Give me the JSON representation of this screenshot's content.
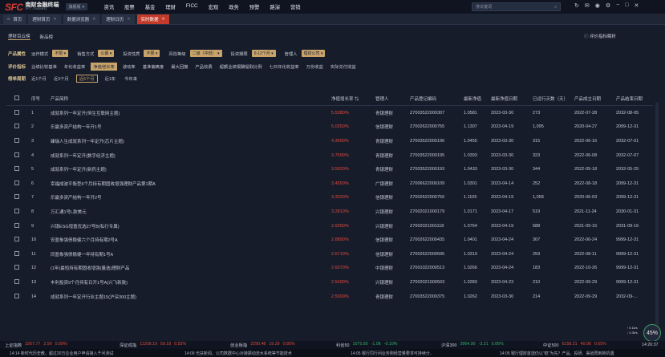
{
  "app": {
    "logo_mark": "SFC",
    "logo_cn": "南财金融终端",
    "logo_en": "SFC CHANNEL",
    "version": "旗舰版"
  },
  "nav": [
    "资讯",
    "股票",
    "基金",
    "理财",
    "FICC",
    "宏观",
    "政务",
    "预警",
    "路演",
    "营销"
  ],
  "search": {
    "placeholder": "搜关键词"
  },
  "tabs": [
    {
      "label": "首页"
    },
    {
      "label": "理财首页"
    },
    {
      "label": "数据浏览器"
    },
    {
      "label": "理财日历"
    },
    {
      "label": "实时数据"
    }
  ],
  "subtabs": {
    "items": [
      "理财百云榜",
      "新品榜"
    ],
    "rating_link": "评价指标解析"
  },
  "filters": {
    "row1": {
      "label": "产品属性",
      "items": [
        {
          "name": "运作模式",
          "value": "不限"
        },
        {
          "name": "销售方式",
          "value": "公募"
        },
        {
          "name": "投资性质",
          "value": "不限"
        },
        {
          "name": "风险等级",
          "value": "二级（中低）"
        },
        {
          "name": "投资期限",
          "value": "6-12个月"
        },
        {
          "name": "管理人",
          "value": "理财公司"
        }
      ]
    },
    "row2": {
      "label": "评价指标",
      "items": [
        "业绩比较基准",
        "年化收益率",
        "净值增长率",
        "波动率",
        "基准偏离度",
        "最大回撤",
        "产品收费",
        "超额业绩报酬提取比例",
        "七日年化收益率",
        "万份收益",
        "实际兑付收益"
      ],
      "active": "净值增长率"
    },
    "row3": {
      "label": "榜单周期",
      "items": [
        "近1个月",
        "近3个月",
        "近6个月",
        "近1年",
        "今年来"
      ],
      "active": "近6个月"
    }
  },
  "table": {
    "headers": [
      "序号",
      "产品简称",
      "净值增长率",
      "管理人",
      "产品登记编码",
      "最新净值",
      "最新净值日期",
      "已运行天数（天）",
      "产品成立日期",
      "产品结束日期"
    ],
    "rows": [
      [
        "1",
        "成就系列一年定开(恒生互联网主题)",
        "5.5380%",
        "青银理财",
        "Z7003522000307",
        "1.0581",
        "2023-03-30",
        "273",
        "2022-07-28",
        "2032-08-05"
      ],
      [
        "2",
        "乐赢多资产结构一年开1号",
        "5.0250%",
        "信银理财",
        "Z7002622000755",
        "1.1307",
        "2023-04-19",
        "1,095",
        "2020-04-27",
        "2099-12-31"
      ],
      [
        "3",
        "臻瑞人生成就系列一年定开(芯片主题)",
        "4.3690%",
        "青银理财",
        "Z7003522000196",
        "1.0455",
        "2023-03-30",
        "315",
        "2022-06-16",
        "2032-07-01"
      ],
      [
        "4",
        "成就系列一年定开(数字经济主题)",
        "3.7590%",
        "青银理财",
        "Z7003522000195",
        "1.0393",
        "2023-03-30",
        "323",
        "2022-06-08",
        "2032-07-07"
      ],
      [
        "5",
        "成就系列一年定开(新药主题)",
        "3.5620%",
        "青银理财",
        "Z7003522000193",
        "1.0433",
        "2023-03-30",
        "344",
        "2022-05-18",
        "2032-05-25"
      ],
      [
        "6",
        "幸福成波平衡型6个月持有期固收增强理财产品第1期A",
        "3.4550%",
        "广银理财",
        "Z7006622000109",
        "1.0301",
        "2023-04-14",
        "252",
        "2022-08-18",
        "2099-12-31"
      ],
      [
        "7",
        "乐赢多资产结构一年开2号",
        "3.3320%",
        "信银理财",
        "Z7002622000756",
        "1.1105",
        "2023-04-19",
        "1,058",
        "2020-06-03",
        "2099-12-31"
      ],
      [
        "8",
        "万汇通1号L款美元",
        "3.2810%",
        "兴银理财",
        "Z7002021000179",
        "1.0171",
        "2023-04-17",
        "519",
        "2021-11-24",
        "2030-01-31"
      ],
      [
        "9",
        "兴银ESG增盈优选27号B(私行专属)",
        "2.9250%",
        "兴银理财",
        "Z7002021001118",
        "1.0764",
        "2023-04-19",
        "588",
        "2021-09-16",
        "2031-09-16"
      ],
      [
        "10",
        "安盈象强债稳健六个月持有期2号A",
        "2.8890%",
        "信银理财",
        "Z7002622000435",
        "1.0401",
        "2023-04-24",
        "307",
        "2022-06-24",
        "9999-12-31"
      ],
      [
        "11",
        "同盈象强债稳健一年持有期1号A",
        "2.6710%",
        "信银理财",
        "Z7002622000595",
        "1.0319",
        "2023-04-24",
        "259",
        "2022-08-11",
        "9999-12-31"
      ],
      [
        "12",
        "(1年)最短持有期固收增强(量选)理财产品",
        "2.6070%",
        "中银理财",
        "Z7001022000513",
        "1.0266",
        "2023-04-24",
        "183",
        "2022-10-26",
        "9999-12-31"
      ],
      [
        "13",
        "丰利投资9个月持有日开1号A(兴飞新款)",
        "2.5490%",
        "兴银理财",
        "Z7002021000503",
        "1.0283",
        "2023-04-23",
        "210",
        "2022-09-29",
        "9999-12-31"
      ],
      [
        "14",
        "成就系列一年定开行业主题15(沪深300主题)",
        "2.5000%",
        "青银理财",
        "Z7003522000375",
        "1.0262",
        "2023-03-30",
        "214",
        "2022-09-29",
        "2032-09-..."
      ]
    ]
  },
  "market": [
    {
      "name": "上证指数",
      "value": "3267.77",
      "chg": "2.90",
      "pct": "0.09%"
    },
    {
      "name": "深证成指",
      "value": "11208.19",
      "chg": "59.18",
      "pct": "0.53%"
    },
    {
      "name": "创业板指",
      "value": "2290.48",
      "chg": "19.29",
      "pct": "0.85%"
    },
    {
      "name": "科创50",
      "value": "1075.80",
      "chg": "-1.06",
      "pct": "-0.10%"
    },
    {
      "name": "沪深300",
      "value": "3964.90",
      "chg": "-3.21",
      "pct": "0.06%"
    },
    {
      "name": "中证500",
      "value": "6158.21",
      "chg": "40.06",
      "pct": "0.65%"
    }
  ],
  "clock": "14:26:37",
  "ticker": [
    "14:14 新时代历史教，超过20万企业用户申请接入千问测试",
    "14:09 光扶新闻，公司数据中心对接振动流水系统等节能技术",
    "14:05 银行同行间业务刚经营量要求可持续分..",
    "14:05 银行理财首选仍以\"稳\"为先？产品、投研、渠道再到新机遇"
  ],
  "speed": {
    "up": "0.1k/s",
    "down": "3.3k/s"
  },
  "gauge": "45%"
}
